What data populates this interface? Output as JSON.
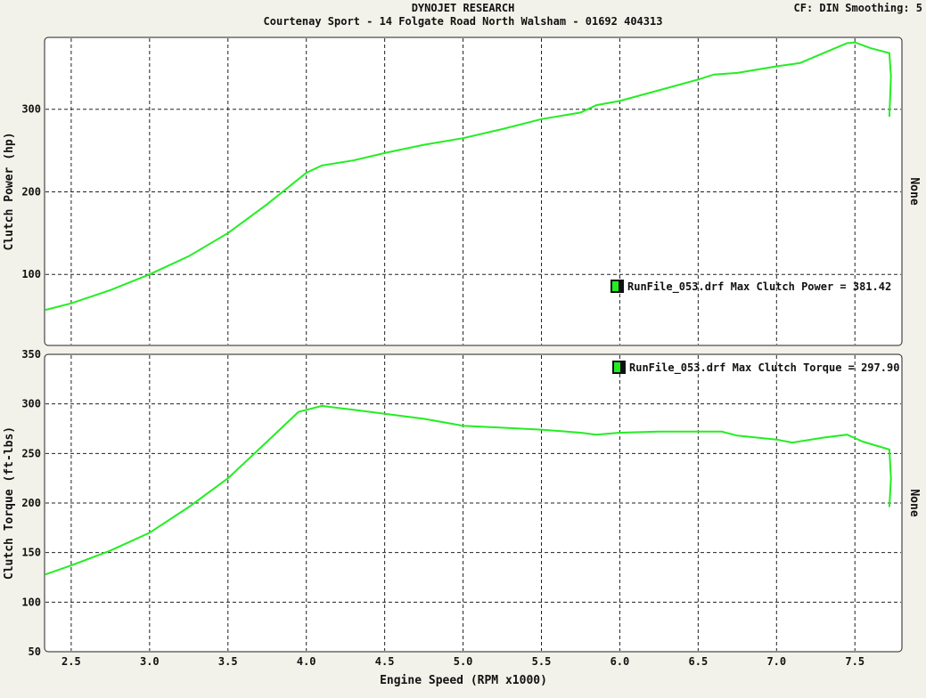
{
  "header": {
    "title": "DYNOJET RESEARCH",
    "subtitle": "Courtenay Sport - 14 Folgate Road North Walsham - 01692 404313",
    "settings": "CF: DIN  Smoothing: 5"
  },
  "colors": {
    "series": "#22ee22",
    "panel_bg": "#ffffff",
    "page_bg": "#f3f2ea"
  },
  "chart_data": [
    {
      "type": "line",
      "ylabel": "Clutch Power (hp)",
      "right_label": "None",
      "xlabel": "",
      "xlim": [
        2.33,
        7.8
      ],
      "ylim": [
        14,
        387
      ],
      "yticks": [
        100,
        200,
        300
      ],
      "legend": {
        "text": "RunFile_053.drf Max Clutch Power = 381.42",
        "placement": "middle-right"
      },
      "series": [
        {
          "name": "RunFile_053.drf",
          "x": [
            2.33,
            2.5,
            2.75,
            3.0,
            3.25,
            3.5,
            3.75,
            4.0,
            4.1,
            4.3,
            4.5,
            4.75,
            5.0,
            5.25,
            5.5,
            5.75,
            5.85,
            6.0,
            6.25,
            6.5,
            6.6,
            6.75,
            7.0,
            7.15,
            7.3,
            7.45,
            7.5,
            7.6,
            7.72,
            7.73,
            7.72
          ],
          "y": [
            57,
            65,
            81,
            100,
            122,
            150,
            185,
            223,
            232,
            238,
            247,
            257,
            265,
            276,
            288,
            296,
            305,
            310,
            323,
            336,
            342,
            344,
            352,
            356,
            368,
            380,
            381,
            374,
            368,
            340,
            291
          ]
        }
      ]
    },
    {
      "type": "line",
      "ylabel": "Clutch Torque (ft-lbs)",
      "right_label": "None",
      "xlabel": "Engine Speed (RPM x1000)",
      "xlim": [
        2.33,
        7.8
      ],
      "ylim": [
        50,
        350
      ],
      "yticks": [
        50,
        100,
        150,
        200,
        250,
        300,
        350
      ],
      "xticks": [
        2.5,
        3.0,
        3.5,
        4.0,
        4.5,
        5.0,
        5.5,
        6.0,
        6.5,
        7.0,
        7.5
      ],
      "legend": {
        "text": "RunFile_053.drf Max Clutch Torque = 297.90",
        "placement": "top-right"
      },
      "series": [
        {
          "name": "RunFile_053.drf",
          "x": [
            2.33,
            2.5,
            2.75,
            3.0,
            3.25,
            3.5,
            3.75,
            3.95,
            4.1,
            4.3,
            4.5,
            4.75,
            5.0,
            5.25,
            5.5,
            5.75,
            5.85,
            6.0,
            6.25,
            6.5,
            6.65,
            6.75,
            7.0,
            7.1,
            7.3,
            7.45,
            7.55,
            7.72,
            7.73,
            7.72
          ],
          "y": [
            128,
            137,
            152,
            170,
            196,
            225,
            262,
            292,
            298,
            294,
            290,
            285,
            278,
            276,
            274,
            271,
            269,
            271,
            272,
            272,
            272,
            268,
            264,
            261,
            266,
            269,
            262,
            254,
            225,
            196
          ]
        }
      ]
    }
  ]
}
